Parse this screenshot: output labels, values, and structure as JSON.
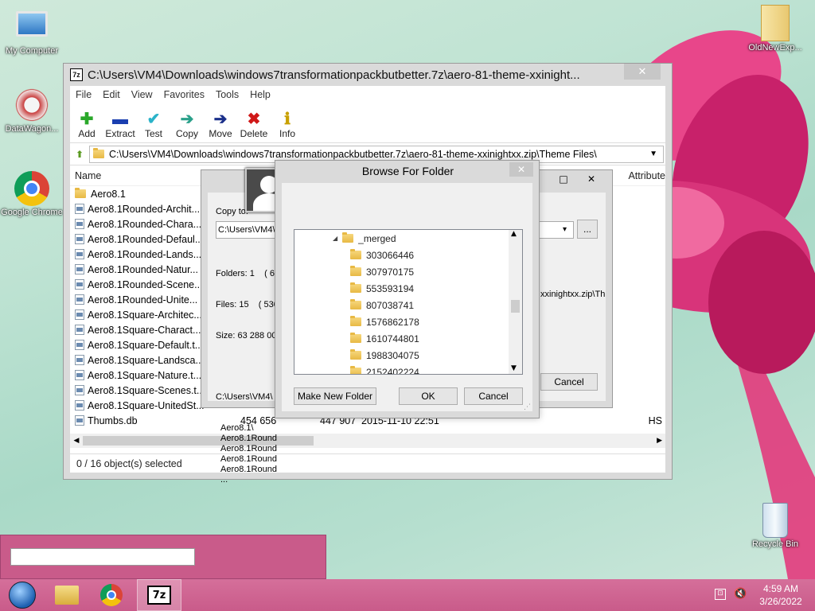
{
  "desktop": {
    "icons": [
      {
        "label": "My Computer",
        "icon": "computer-icon"
      },
      {
        "label": "DataWagon...",
        "icon": "datawagon-icon"
      },
      {
        "label": "Google Chrome",
        "icon": "chrome-icon"
      },
      {
        "label": "OldNewExp...",
        "icon": "folder-icon"
      },
      {
        "label": "Recycle Bin",
        "icon": "recycle-bin-icon"
      }
    ]
  },
  "main_window": {
    "title": "C:\\Users\\VM4\\Downloads\\windows7transformationpackbutbetter.7z\\aero-81-theme-xxinight...",
    "app_icon": "7z",
    "close_glyph": "✕",
    "menu": [
      "File",
      "Edit",
      "View",
      "Favorites",
      "Tools",
      "Help"
    ],
    "toolbar": [
      {
        "label": "Add",
        "icon": "plus-icon",
        "glyph": "✚",
        "color": "#2aa82a"
      },
      {
        "label": "Extract",
        "icon": "minus-icon",
        "glyph": "▬",
        "color": "#1a3fb0"
      },
      {
        "label": "Test",
        "icon": "check-icon",
        "glyph": "✔",
        "color": "#2bb3c9"
      },
      {
        "label": "Copy",
        "icon": "arrow-copy-icon",
        "glyph": "➔",
        "color": "#2aa08a"
      },
      {
        "label": "Move",
        "icon": "arrow-move-icon",
        "glyph": "➔",
        "color": "#1a2f8a"
      },
      {
        "label": "Delete",
        "icon": "delete-x-icon",
        "glyph": "✖",
        "color": "#d01818"
      },
      {
        "label": "Info",
        "icon": "info-icon",
        "glyph": "ℹ",
        "color": "#c8a000"
      }
    ],
    "address": "C:\\Users\\VM4\\Downloads\\windows7transformationpackbutbetter.7z\\aero-81-theme-xxinightxx.zip\\Theme Files\\",
    "columns": {
      "name": "Name",
      "attributes": "Attribute"
    },
    "files": [
      {
        "name": "Aero8.1",
        "type": "folder"
      },
      {
        "name": "Aero8.1Rounded-Archit...",
        "type": "file"
      },
      {
        "name": "Aero8.1Rounded-Chara...",
        "type": "file"
      },
      {
        "name": "Aero8.1Rounded-Defaul...",
        "type": "file"
      },
      {
        "name": "Aero8.1Rounded-Lands...",
        "type": "file"
      },
      {
        "name": "Aero8.1Rounded-Natur...",
        "type": "file"
      },
      {
        "name": "Aero8.1Rounded-Scene...",
        "type": "file"
      },
      {
        "name": "Aero8.1Rounded-Unite...",
        "type": "file"
      },
      {
        "name": "Aero8.1Square-Architec...",
        "type": "file"
      },
      {
        "name": "Aero8.1Square-Charact...",
        "type": "file"
      },
      {
        "name": "Aero8.1Square-Default.t...",
        "type": "file"
      },
      {
        "name": "Aero8.1Square-Landsca...",
        "type": "file"
      },
      {
        "name": "Aero8.1Square-Nature.t...",
        "type": "file"
      },
      {
        "name": "Aero8.1Square-Scenes.t...",
        "type": "file"
      },
      {
        "name": "Aero8.1Square-UnitedSt...",
        "type": "file"
      },
      {
        "name": "Thumbs.db",
        "type": "file",
        "size": "454 656",
        "packed": "447 907",
        "modified": "2015-11-10 22:51",
        "attr": "HS"
      }
    ],
    "status": "0 / 16 object(s) selected"
  },
  "copy_dialog": {
    "copy_to_label": "Copy to:",
    "path_value": "C:\\Users\\VM4\\",
    "browse_btn": "...",
    "folders_line": "Folders: 1    ( 62",
    "files_line": "Files: 15    ( 530",
    "size_line": "Size: 63 288 00",
    "path_line": "C:\\Users\\VM4\\",
    "items": [
      "Aero8.1\\",
      "Aero8.1Round",
      "Aero8.1Round",
      "Aero8.1Round",
      "Aero8.1Round",
      "..."
    ],
    "right_path": "xxinightxx.zip\\Th",
    "cancel": "Cancel",
    "close_glyph": "✕",
    "max_glyph": "□"
  },
  "browse_dialog": {
    "title": "Browse For Folder",
    "close_glyph": "✕",
    "tree": [
      {
        "label": "_merged",
        "expanded": true
      },
      {
        "label": "303066446"
      },
      {
        "label": "307970175"
      },
      {
        "label": "553593194"
      },
      {
        "label": "807038741"
      },
      {
        "label": "1576862178"
      },
      {
        "label": "1610744801"
      },
      {
        "label": "1988304075"
      },
      {
        "label": "2152402224"
      }
    ],
    "make_new_folder": "Make New Folder",
    "ok": "OK",
    "cancel": "Cancel"
  },
  "taskbar": {
    "time": "4:59 AM",
    "date": "3/26/2022",
    "buttons": [
      "start-orb-icon",
      "file-explorer-icon",
      "chrome-icon",
      "7zip-icon"
    ],
    "active_label": "7z"
  }
}
